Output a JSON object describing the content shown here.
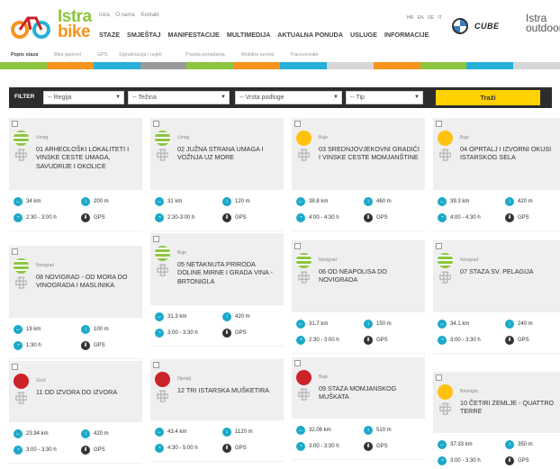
{
  "header": {
    "logo_word1": "Istra",
    "logo_word2": "bike",
    "toplinks": [
      "Istra",
      "O nama",
      "Kontakt"
    ],
    "nav": [
      "STAZE",
      "SMJEŠTAJ",
      "MANIFESTACIJE",
      "MULTIMEDIJA",
      "AKTUALNA PONUDA",
      "USLUGE",
      "INFORMACIJE"
    ],
    "languages": [
      "HR",
      "EN",
      "DE",
      "IT"
    ],
    "sponsor_cube": "CUBE",
    "sponsor_istra": "Istra outdoor"
  },
  "subtabs": [
    "Popis staza",
    "Bike parkovi",
    "GPS",
    "Signalizacija i uvjeti",
    "Pravila ponašanja",
    "Mobilne servisi",
    "Transverzale"
  ],
  "colors": {
    "stripe": [
      "#8cc63f",
      "#f7941d",
      "#26b0d8",
      "#999999",
      "#8cc63f",
      "#f7941d",
      "#26b0d8",
      "#d6d6d6",
      "#f7941d",
      "#8cc63f",
      "#26b0d8",
      "#d6d6d6"
    ],
    "easy": "#8cc63f",
    "medium": "#ffc20e",
    "hard": "#cc2229",
    "accent": "#1ba9c9",
    "search": "#ffd200"
  },
  "filter": {
    "label": "FILTER",
    "region": "-- Regija",
    "difficulty": "-- Težina",
    "surface": "-- Vrsta podloge",
    "type": "-- Tip",
    "search_label": "Traži"
  },
  "trails": [
    {
      "town": "Umag",
      "title": "01 ARHEOLOŠKI LOKALITETI I VINSKE CESTE UMAGA, SAVUDRIJE I OKOLICE",
      "distance": "34 km",
      "elevation": "200 m",
      "time": "2:30 - 3:00 h",
      "gps": "GPS",
      "difficulty": "easy"
    },
    {
      "town": "Umag",
      "title": "02 JUŽNA STRANA UMAGA I VOŽNJA UZ MORE",
      "distance": "31 km",
      "elevation": "120 m",
      "time": "2:30-3:00 h",
      "gps": "GPS",
      "difficulty": "easy"
    },
    {
      "town": "Buje",
      "title": "03 SREDNJOVJEKOVNI GRADIĆI I VINSKE CESTE MOMJANŠTINE",
      "distance": "38.8 km",
      "elevation": "460 m",
      "time": "4:00 - 4:30 h",
      "gps": "GPS",
      "difficulty": "medium"
    },
    {
      "town": "Buje",
      "title": "04 OPRTALJ I IZVORNI OKUSI ISTARSKOG SELA",
      "distance": "39.3 km",
      "elevation": "420 m",
      "time": "4:00 - 4:30 h",
      "gps": "GPS",
      "difficulty": "medium"
    },
    {
      "town": "Novigrad",
      "title": "08 NOVIGRAD - OD MORA DO VINOGRADA I MASLINIKA",
      "distance": "19 km",
      "elevation": "100 m",
      "time": "1:30 h",
      "gps": "GPS",
      "difficulty": "easy"
    },
    {
      "town": "Buje",
      "title": "05 NETAKNUTA PRIRODA DOLINE MIRNE I GRADA VINA - BRTONIGLA",
      "distance": "31.3 km",
      "elevation": "420 m",
      "time": "3:00 - 3:30 h",
      "gps": "GPS",
      "difficulty": "easy"
    },
    {
      "town": "Novigrad",
      "title": "06 OD NEAPOLISA DO NOVIGRADA",
      "distance": "31.7 km",
      "elevation": "150 m",
      "time": "2:30 - 3:00 h",
      "gps": "GPS",
      "difficulty": "easy"
    },
    {
      "town": "Novigrad",
      "title": "07 STAZA SV. PELAGIJA",
      "distance": "34.1 km",
      "elevation": "240 m",
      "time": "3:00 - 3:30 h",
      "gps": "GPS",
      "difficulty": "easy"
    },
    {
      "town": "Grož",
      "title": "11 OD IZVORA DO IZVORA",
      "distance": "23.94 km",
      "elevation": "420 m",
      "time": "3:00 - 3:30 h",
      "gps": "GPS",
      "difficulty": "hard"
    },
    {
      "town": "Oprtalj",
      "title": "12 TRI ISTARSKA MUŠKETIRA",
      "distance": "43.4 km",
      "elevation": "1120 m",
      "time": "4:30 - 5:00 h",
      "gps": "GPS",
      "difficulty": "hard"
    },
    {
      "town": "Buje",
      "title": "09 STAZA MOMJANSKOG MUŠKATA",
      "distance": "32.08 km",
      "elevation": "510 m",
      "time": "3:00 - 3:30 h",
      "gps": "GPS",
      "difficulty": "hard"
    },
    {
      "town": "Brtonigla",
      "title": "10 ČETIRI ZEMLJE - QUATTRO TERRE",
      "distance": "37.33 km",
      "elevation": "350 m",
      "time": "3:00 - 3:30 h",
      "gps": "GPS",
      "difficulty": "medium"
    }
  ]
}
